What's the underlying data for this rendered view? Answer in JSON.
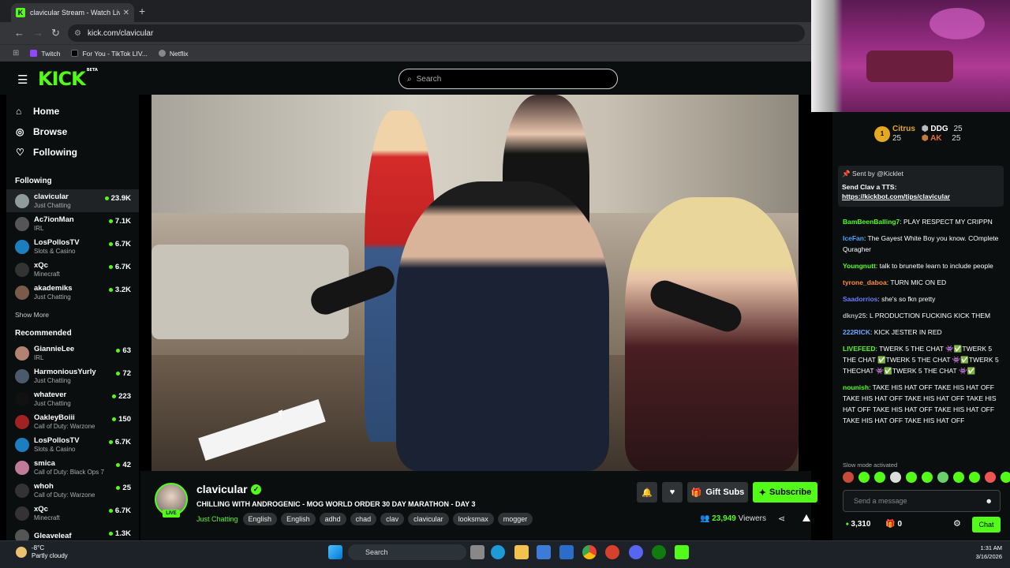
{
  "browser": {
    "tab_title": "clavicular Stream - Watch Live o",
    "tab_close": "✕",
    "new_tab": "+",
    "url": "kick.com/clavicular",
    "bookmarks": [
      {
        "label": "Twitch",
        "color": "#9146ff"
      },
      {
        "label": "For You - TikTok LIV...",
        "color": "#222"
      },
      {
        "label": "Netflix",
        "color": "#888"
      }
    ]
  },
  "kick": {
    "logo": "KICK",
    "logo_beta": "BETA",
    "search_placeholder": "Search",
    "accent": "#53fc18"
  },
  "sidebar": {
    "nav": [
      {
        "label": "Home",
        "icon": "⌂"
      },
      {
        "label": "Browse",
        "icon": "◎"
      },
      {
        "label": "Following",
        "icon": "♡"
      }
    ],
    "following_title": "Following",
    "following": [
      {
        "name": "clavicular",
        "category": "Just Chatting",
        "viewers": "23.9K",
        "color": "#8f9c9a",
        "active": true
      },
      {
        "name": "Ac7ionMan",
        "category": "IRL",
        "viewers": "7.1K",
        "color": "#555"
      },
      {
        "name": "LosPollosTV",
        "category": "Slots & Casino",
        "viewers": "6.7K",
        "color": "#1b7fbf"
      },
      {
        "name": "xQc",
        "category": "Minecraft",
        "viewers": "6.7K",
        "color": "#333"
      },
      {
        "name": "akademiks",
        "category": "Just Chatting",
        "viewers": "3.2K",
        "color": "#7a5b4a"
      }
    ],
    "show_more": "Show More",
    "recommended_title": "Recommended",
    "recommended": [
      {
        "name": "GiannieLee",
        "category": "IRL",
        "viewers": "63",
        "color": "#b08470"
      },
      {
        "name": "HarmoniousYurly",
        "category": "Just Chatting",
        "viewers": "72",
        "color": "#4a5a6a"
      },
      {
        "name": "whatever",
        "category": "Just Chatting",
        "viewers": "223",
        "color": "#111"
      },
      {
        "name": "OakleyBoiii",
        "category": "Call of Duty: Warzone",
        "viewers": "150",
        "color": "#a02222"
      },
      {
        "name": "LosPollosTV",
        "category": "Slots & Casino",
        "viewers": "6.7K",
        "color": "#1b7fbf"
      },
      {
        "name": "smica",
        "category": "Call of Duty: Black Ops 7",
        "viewers": "42",
        "color": "#c07a9a"
      },
      {
        "name": "whoh",
        "category": "Call of Duty: Warzone",
        "viewers": "25",
        "color": "#333"
      },
      {
        "name": "xQc",
        "category": "Minecraft",
        "viewers": "6.7K",
        "color": "#333"
      },
      {
        "name": "Gleaveleaf",
        "category": "",
        "viewers": "1.3K",
        "color": "#555"
      }
    ]
  },
  "stream": {
    "channel": "clavicular",
    "live": "LIVE",
    "title": "CHILLING WITH ANDROGENIC - MOG WORLD ORDER 30 DAY MARATHON - DAY 3",
    "category": "Just Chatting",
    "tags": [
      "English",
      "English",
      "adhd",
      "chad",
      "clav",
      "clavicular",
      "looksmax",
      "mogger"
    ],
    "gift_label": "Gift Subs",
    "subscribe_label": "Subscribe",
    "viewers": "23,949",
    "viewers_label": "Viewers"
  },
  "chat": {
    "gifters": [
      {
        "name": "Citrus",
        "count": "25",
        "color": "#e5a823"
      },
      {
        "name": "DDG",
        "count": "25",
        "color": "#bbb"
      },
      {
        "name": "AK",
        "count": "25",
        "color": "#c6793a"
      }
    ],
    "pinned_by": "Sent by",
    "pinned_user": "@Kicklet",
    "pinned_heading": "Send Clav a TTS:",
    "pinned_link": "https://kickbot.com/tips/clavicular",
    "messages": [
      {
        "user": "BamBeenBalling7",
        "color": "#53fc18",
        "text": "PLAY RESPECT MY CRIPPN"
      },
      {
        "user": "IceFan",
        "color": "#4aa3ff",
        "text": "The Gayest White Boy you know. COmplete Quragher"
      },
      {
        "user": "Youngnutt",
        "color": "#53fc18",
        "text": "talk to brunette learn to include people"
      },
      {
        "user": "tyrone_daboa",
        "color": "#ff8c3a",
        "text": "TURN MIC ON ED"
      },
      {
        "user": "Saadorrios",
        "color": "#6f7dff",
        "text": "she's so fkn pretty"
      },
      {
        "user": "dkny25",
        "color": "#b7b7b7",
        "text": "L PRODUCTION FUCKING KICK THEM"
      },
      {
        "user": "222RICK",
        "color": "#6fa8ff",
        "text": "KICK JESTER IN RED"
      },
      {
        "user": "LIVEFEED",
        "color": "#53fc18",
        "text": "TWERK 5 THE CHAT 👾✅TWERK 5 THE CHAT ✅TWERK 5 THE CHAT 👾✅TWERK 5 THECHAT 👾✅TWERK 5 THE CHAT 👾✅"
      },
      {
        "user": "nounish",
        "color": "#53fc18",
        "text": "TAKE HIS HAT OFF TAKE HIS HAT OFF TAKE HIS HAT OFF TAKE HIS HAT OFF TAKE HIS HAT OFF TAKE HIS HAT OFF TAKE HIS HAT OFF TAKE HIS HAT OFF TAKE HIS HAT OFF"
      }
    ],
    "slow_mode": "Slow mode activated",
    "input_placeholder": "Send a message",
    "points": "3,310",
    "gifts": "0",
    "send_label": "Chat"
  },
  "taskbar": {
    "temp": "-8°C",
    "weather": "Partly cloudy",
    "search": "Search",
    "time": "1:31 AM",
    "date": "3/16/2026"
  }
}
